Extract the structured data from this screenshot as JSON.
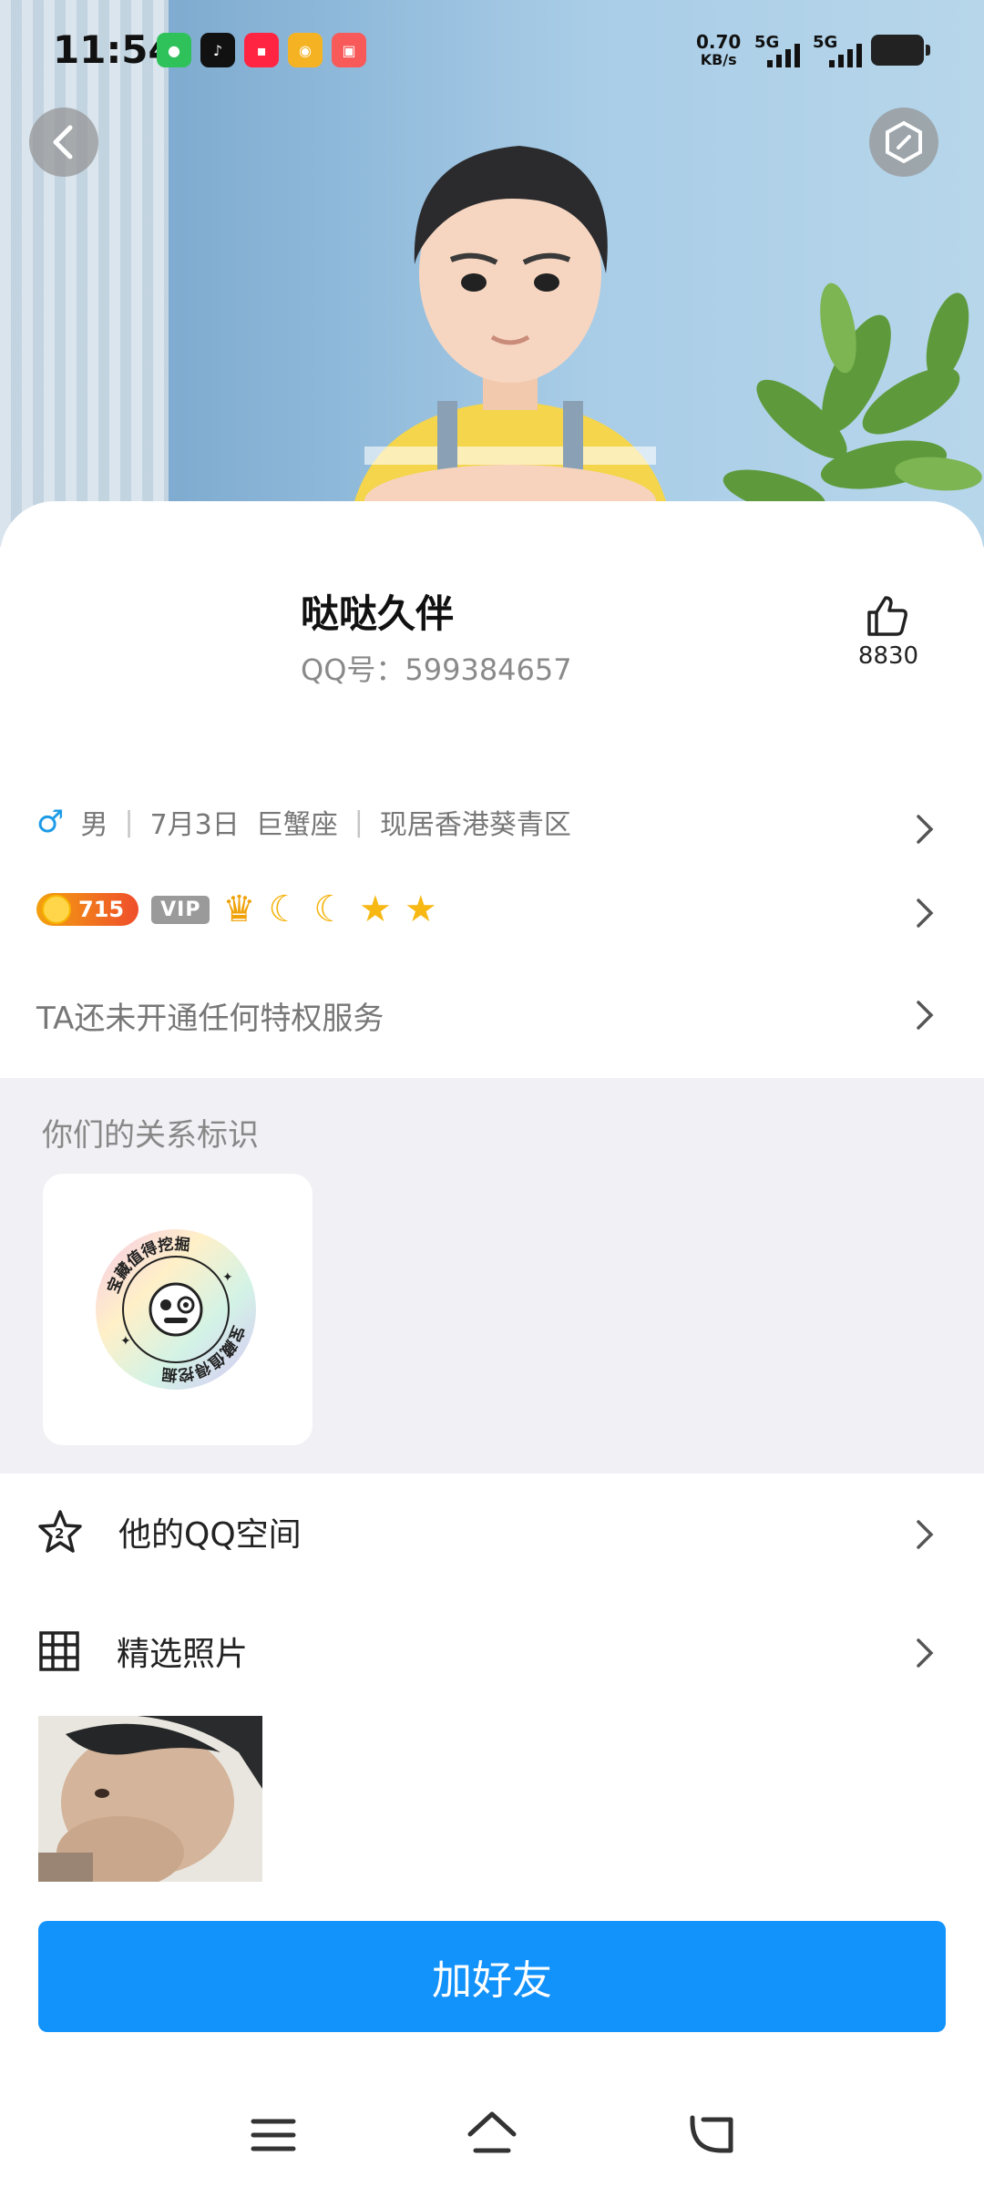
{
  "status_bar": {
    "time": "11:54",
    "app_icons": [
      "wechat-icon",
      "tiktok-icon",
      "xiaohongshu-icon",
      "weibo-icon",
      "toutiao-icon"
    ],
    "net_speed_value": "0.70",
    "net_speed_unit": "KB/s",
    "signal1_label": "5G",
    "signal2_label": "5G"
  },
  "header": {
    "back_icon": "chevron-left-icon",
    "settings_icon": "hexagon-icon"
  },
  "profile": {
    "name": "哒哒久伴",
    "qq_number": "QQ号：599384657",
    "likes": "8830"
  },
  "info": {
    "gender": "男",
    "birthday": "7月3日",
    "zodiac": "巨蟹座",
    "location": "现居香港葵青区",
    "sep": "|"
  },
  "badges": {
    "level": "715",
    "vip": "VIP"
  },
  "privilege_text": "TA还未开通任何特权服务",
  "relation": {
    "title": "你们的关系标识",
    "badge_ring_text": "宝藏值得挖掘"
  },
  "list": {
    "qzone": "他的QQ空间",
    "photos": "精选照片"
  },
  "primary_button": "加好友",
  "colors": {
    "accent": "#1292fb",
    "gender_male": "#1d9be6",
    "relation_bg": "#f0f0f5"
  }
}
